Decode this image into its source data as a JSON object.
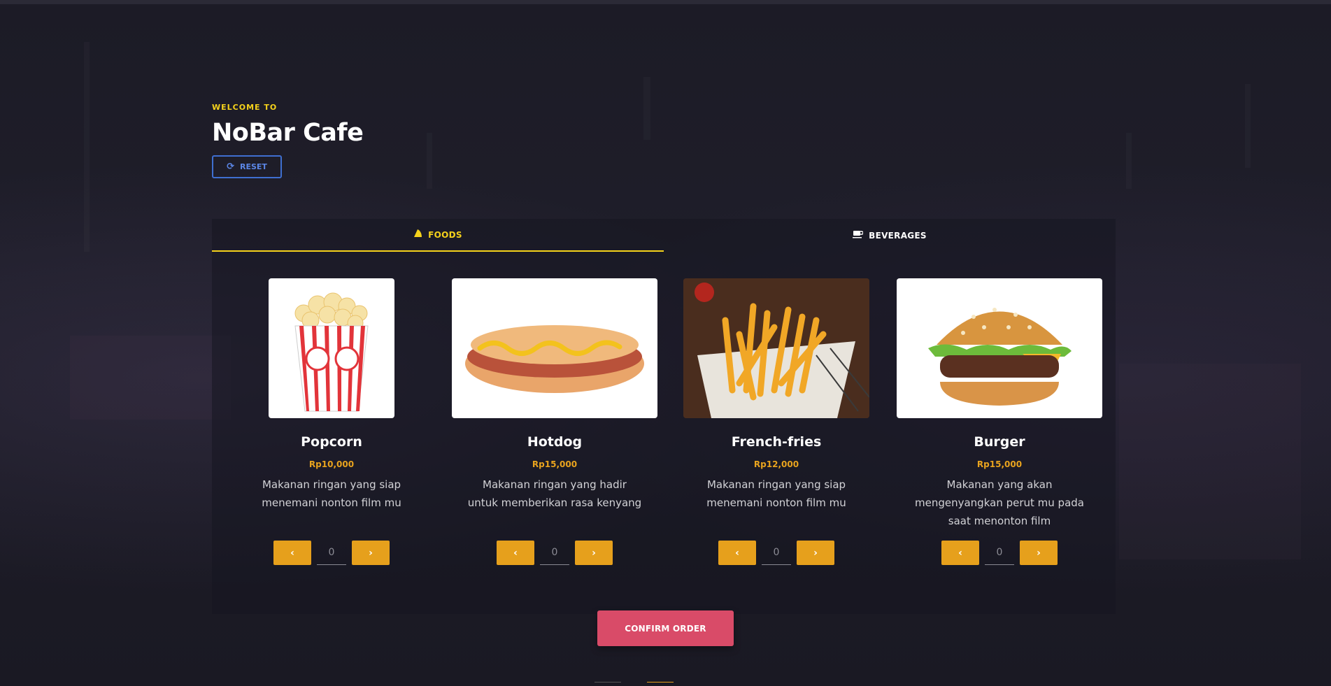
{
  "hero": {
    "welcome": "WELCOME TO",
    "brand": "NoBar Cafe",
    "reset_label": "RESET"
  },
  "tabs": [
    {
      "label": "FOODS",
      "icon": "nacho-icon",
      "active": true
    },
    {
      "label": "BEVERAGES",
      "icon": "mug-icon",
      "active": false
    }
  ],
  "products": [
    {
      "name": "Popcorn",
      "price": "Rp10,000",
      "desc": "Makanan ringan yang siap menemani nonton film mu",
      "qty": "0",
      "image": "popcorn-image"
    },
    {
      "name": "Hotdog",
      "price": "Rp15,000",
      "desc": "Makanan ringan yang hadir untuk memberikan rasa kenyang",
      "qty": "0",
      "image": "hotdog-image"
    },
    {
      "name": "French-fries",
      "price": "Rp12,000",
      "desc": "Makanan ringan yang siap menemani nonton film mu",
      "qty": "0",
      "image": "french-fries-image"
    },
    {
      "name": "Burger",
      "price": "Rp15,000",
      "desc": "Makanan yang akan mengenyangkan perut mu pada saat menonton film",
      "qty": "0",
      "image": "burger-image"
    }
  ],
  "qty_controls": {
    "decrement": "‹",
    "increment": "›"
  },
  "confirm_label": "CONFIRM ORDER",
  "colors": {
    "accent_yellow": "#f5d21b",
    "accent_orange": "#e6a01c",
    "confirm": "#d94b68",
    "reset_blue": "#3f6fd0"
  }
}
